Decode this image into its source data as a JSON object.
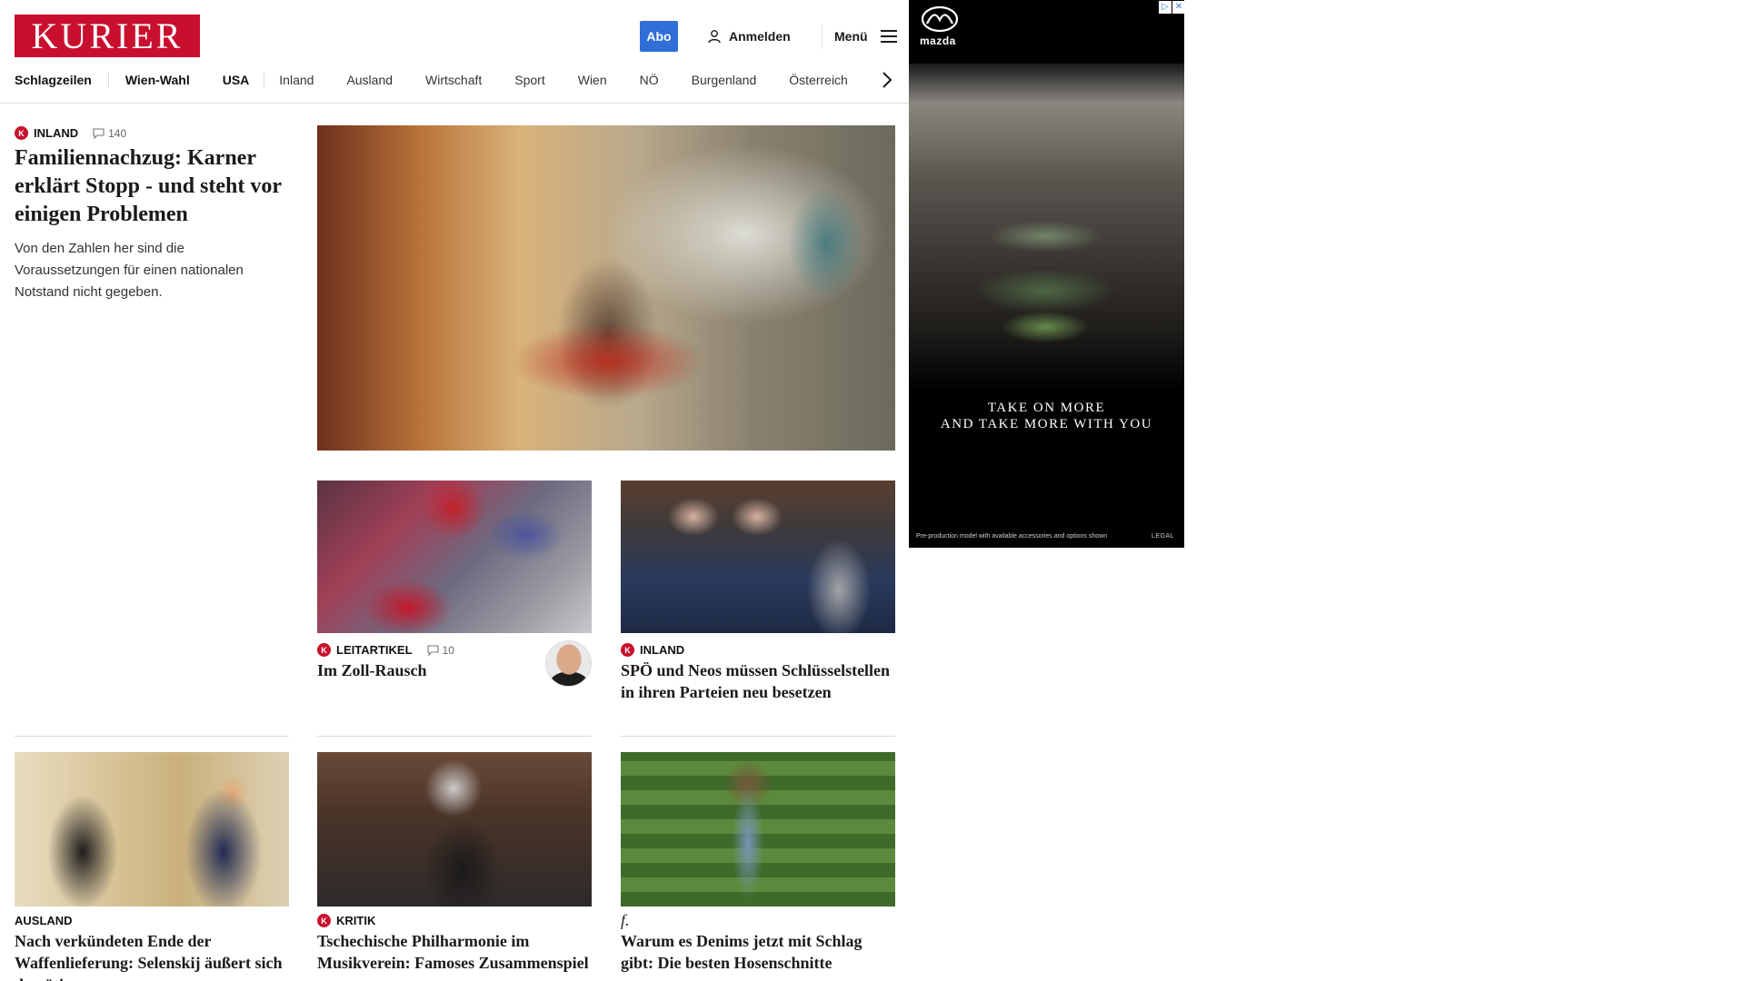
{
  "header": {
    "logo_text": "KURIER",
    "abo_label": "Abo",
    "login_label": "Anmelden",
    "menu_label": "Menü"
  },
  "nav": {
    "items": [
      "Schlagzeilen",
      "Wien-Wahl",
      "USA",
      "Inland",
      "Ausland",
      "Wirtschaft",
      "Sport",
      "Wien",
      "NÖ",
      "Burgenland",
      "Österreich"
    ]
  },
  "lead": {
    "category": "INLAND",
    "comments": "140",
    "title": "Familiennachzug: Karner erklärt Stopp - und steht vor einigen Problemen",
    "teaser": "Von den Zahlen her sind die Voraussetzungen für einen nationalen Notstand nicht gegeben."
  },
  "articles": [
    {
      "category": "LEITARTIKEL",
      "comments": "10",
      "title": "Im Zoll-Rausch"
    },
    {
      "category": "INLAND",
      "title": "SPÖ und Neos müssen Schlüsselstellen in ihren Parteien neu besetzen"
    },
    {
      "category": "AUSLAND",
      "title": "Nach verkündeten Ende der Waffenlieferung: Selenskij äußert sich demütig"
    },
    {
      "category": "KRITIK",
      "title": "Tschechische Philharmonie im Musikverein: Famoses Zusammenspiel"
    },
    {
      "category_logo": "f.",
      "title": "Warum es Denims jetzt mit Schlag gibt: Die besten Hosenschnitte"
    }
  ],
  "badge_letter": "K",
  "ad": {
    "brand": "mazda",
    "headline_line1": "TAKE ON MORE",
    "headline_line2": "AND TAKE MORE WITH YOU",
    "disclaimer": "Pre-production model with available accessories and options shown",
    "legal": "LEGAL",
    "adchoices": "▷",
    "close": "✕"
  },
  "colors": {
    "brand_red": "#c8102e",
    "abo_blue": "#2f6fd6"
  }
}
